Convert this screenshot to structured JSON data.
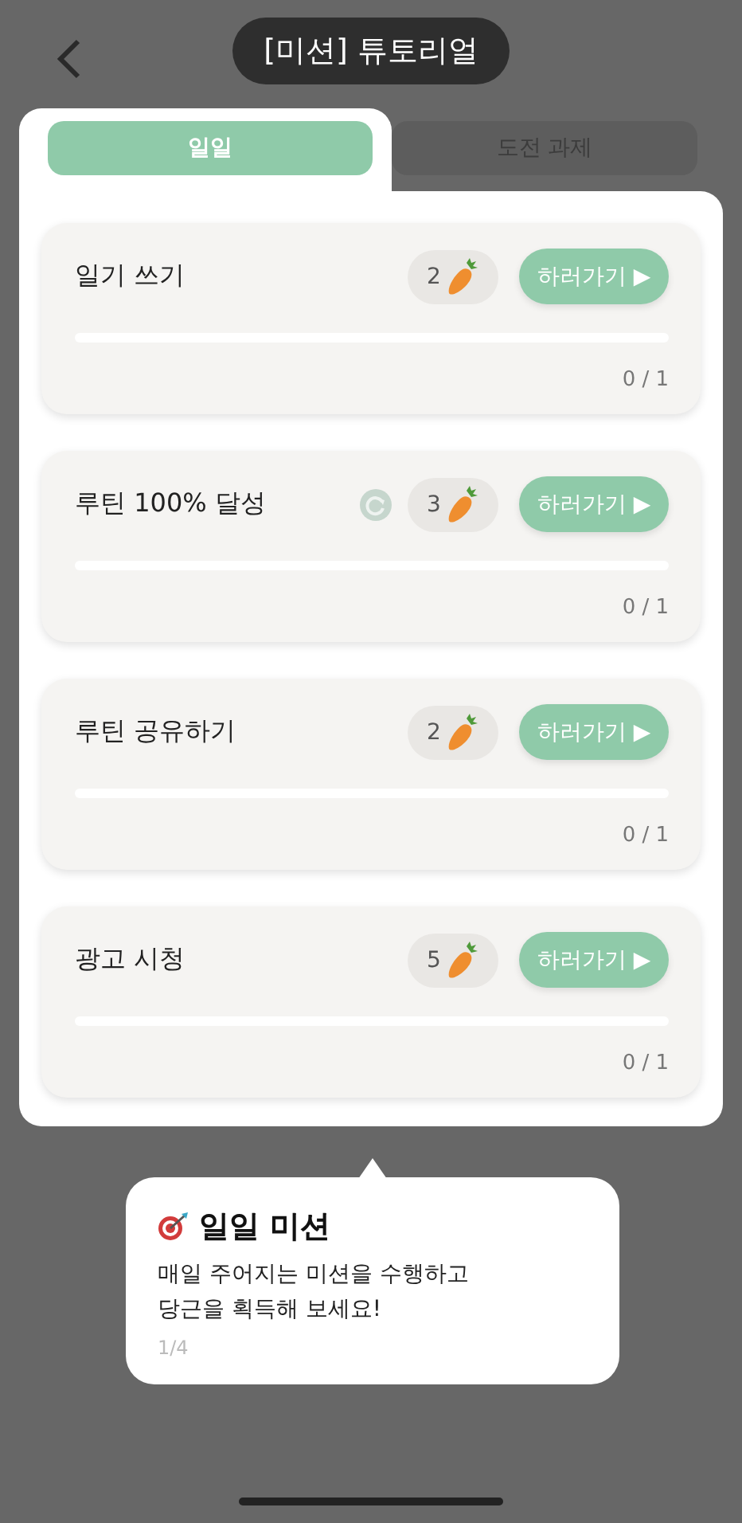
{
  "header": {
    "title": "[미션] 튜토리얼"
  },
  "tabs": [
    {
      "label": "일일",
      "selected": true
    },
    {
      "label": "도전 과제",
      "selected": false
    }
  ],
  "missions": [
    {
      "name": "일기 쓰기",
      "refreshable": false,
      "reward": "2",
      "button": "하러가기 ▶",
      "level": 0,
      "progress": "0 / 1"
    },
    {
      "name": "루틴 100% 달성",
      "refreshable": true,
      "reward": "3",
      "button": "하러가기 ▶",
      "level": 0,
      "progress": "0 / 1"
    },
    {
      "name": "루틴 공유하기",
      "refreshable": false,
      "reward": "2",
      "button": "하러가기 ▶",
      "level": 0,
      "progress": "0 / 1"
    },
    {
      "name": "광고 시청",
      "refreshable": false,
      "reward": "5",
      "button": "하러가기 ▶",
      "level": 0,
      "progress": "0 / 1"
    }
  ],
  "tooltip": {
    "title": "일일 미션",
    "text": "매일 주어지는 미션을 수행하고\n당근을 획득해 보세요!",
    "step": "1/4"
  }
}
